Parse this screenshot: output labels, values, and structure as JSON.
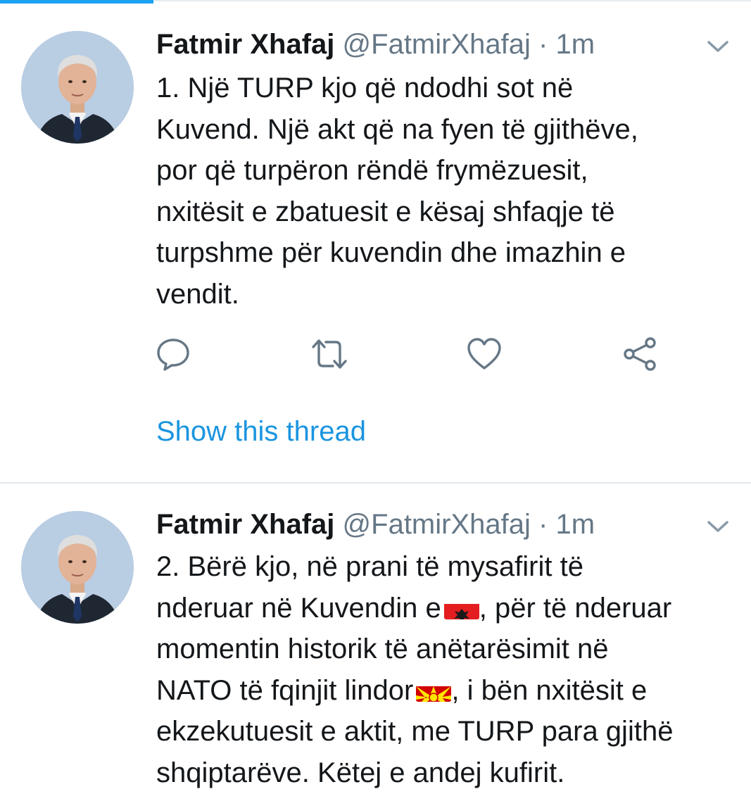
{
  "tweets": [
    {
      "name": "Fatmir Xhafaj",
      "handle": "@FatmirXhafaj",
      "separator": "·",
      "time": "1m",
      "lines": [
        "1. Një TURP kjo që ndodhi sot në",
        "Kuvend. Një akt që na fyen të gjithëve,",
        "por që turpëron rëndë frymëzuesit,",
        "nxitësit e zbatuesit e kësaj shfaqje të",
        "turpshme për kuvendin dhe imazhin e",
        "vendit."
      ],
      "show_thread": "Show this thread"
    },
    {
      "name": "Fatmir Xhafaj",
      "handle": "@FatmirXhafaj",
      "separator": "·",
      "time": "1m",
      "lines": [
        "2. Bërë kjo, në prani të mysafirit të",
        "nderuar në Kuvendin e",
        ", për të nderuar",
        "momentin historik të anëtarësimit në",
        "NATO të fqinjit lindor",
        ", i bën nxitësit e",
        "ekzekutuesit e aktit, me TURP para gjithë",
        "shqiptarëve. Këtej e andej kufirit."
      ],
      "emoji": [
        "albania-flag-emoji",
        "north-macedonia-flag-emoji"
      ]
    }
  ],
  "icons": {
    "reply": "reply-icon",
    "retweet": "retweet-icon",
    "like": "like-icon",
    "share": "share-icon",
    "caret": "chevron-down-icon"
  },
  "colors": {
    "text": "#14171a",
    "secondary": "#657786",
    "link": "#1b95e0",
    "accent": "#1da1f2",
    "separator": "#e1e8ed"
  }
}
